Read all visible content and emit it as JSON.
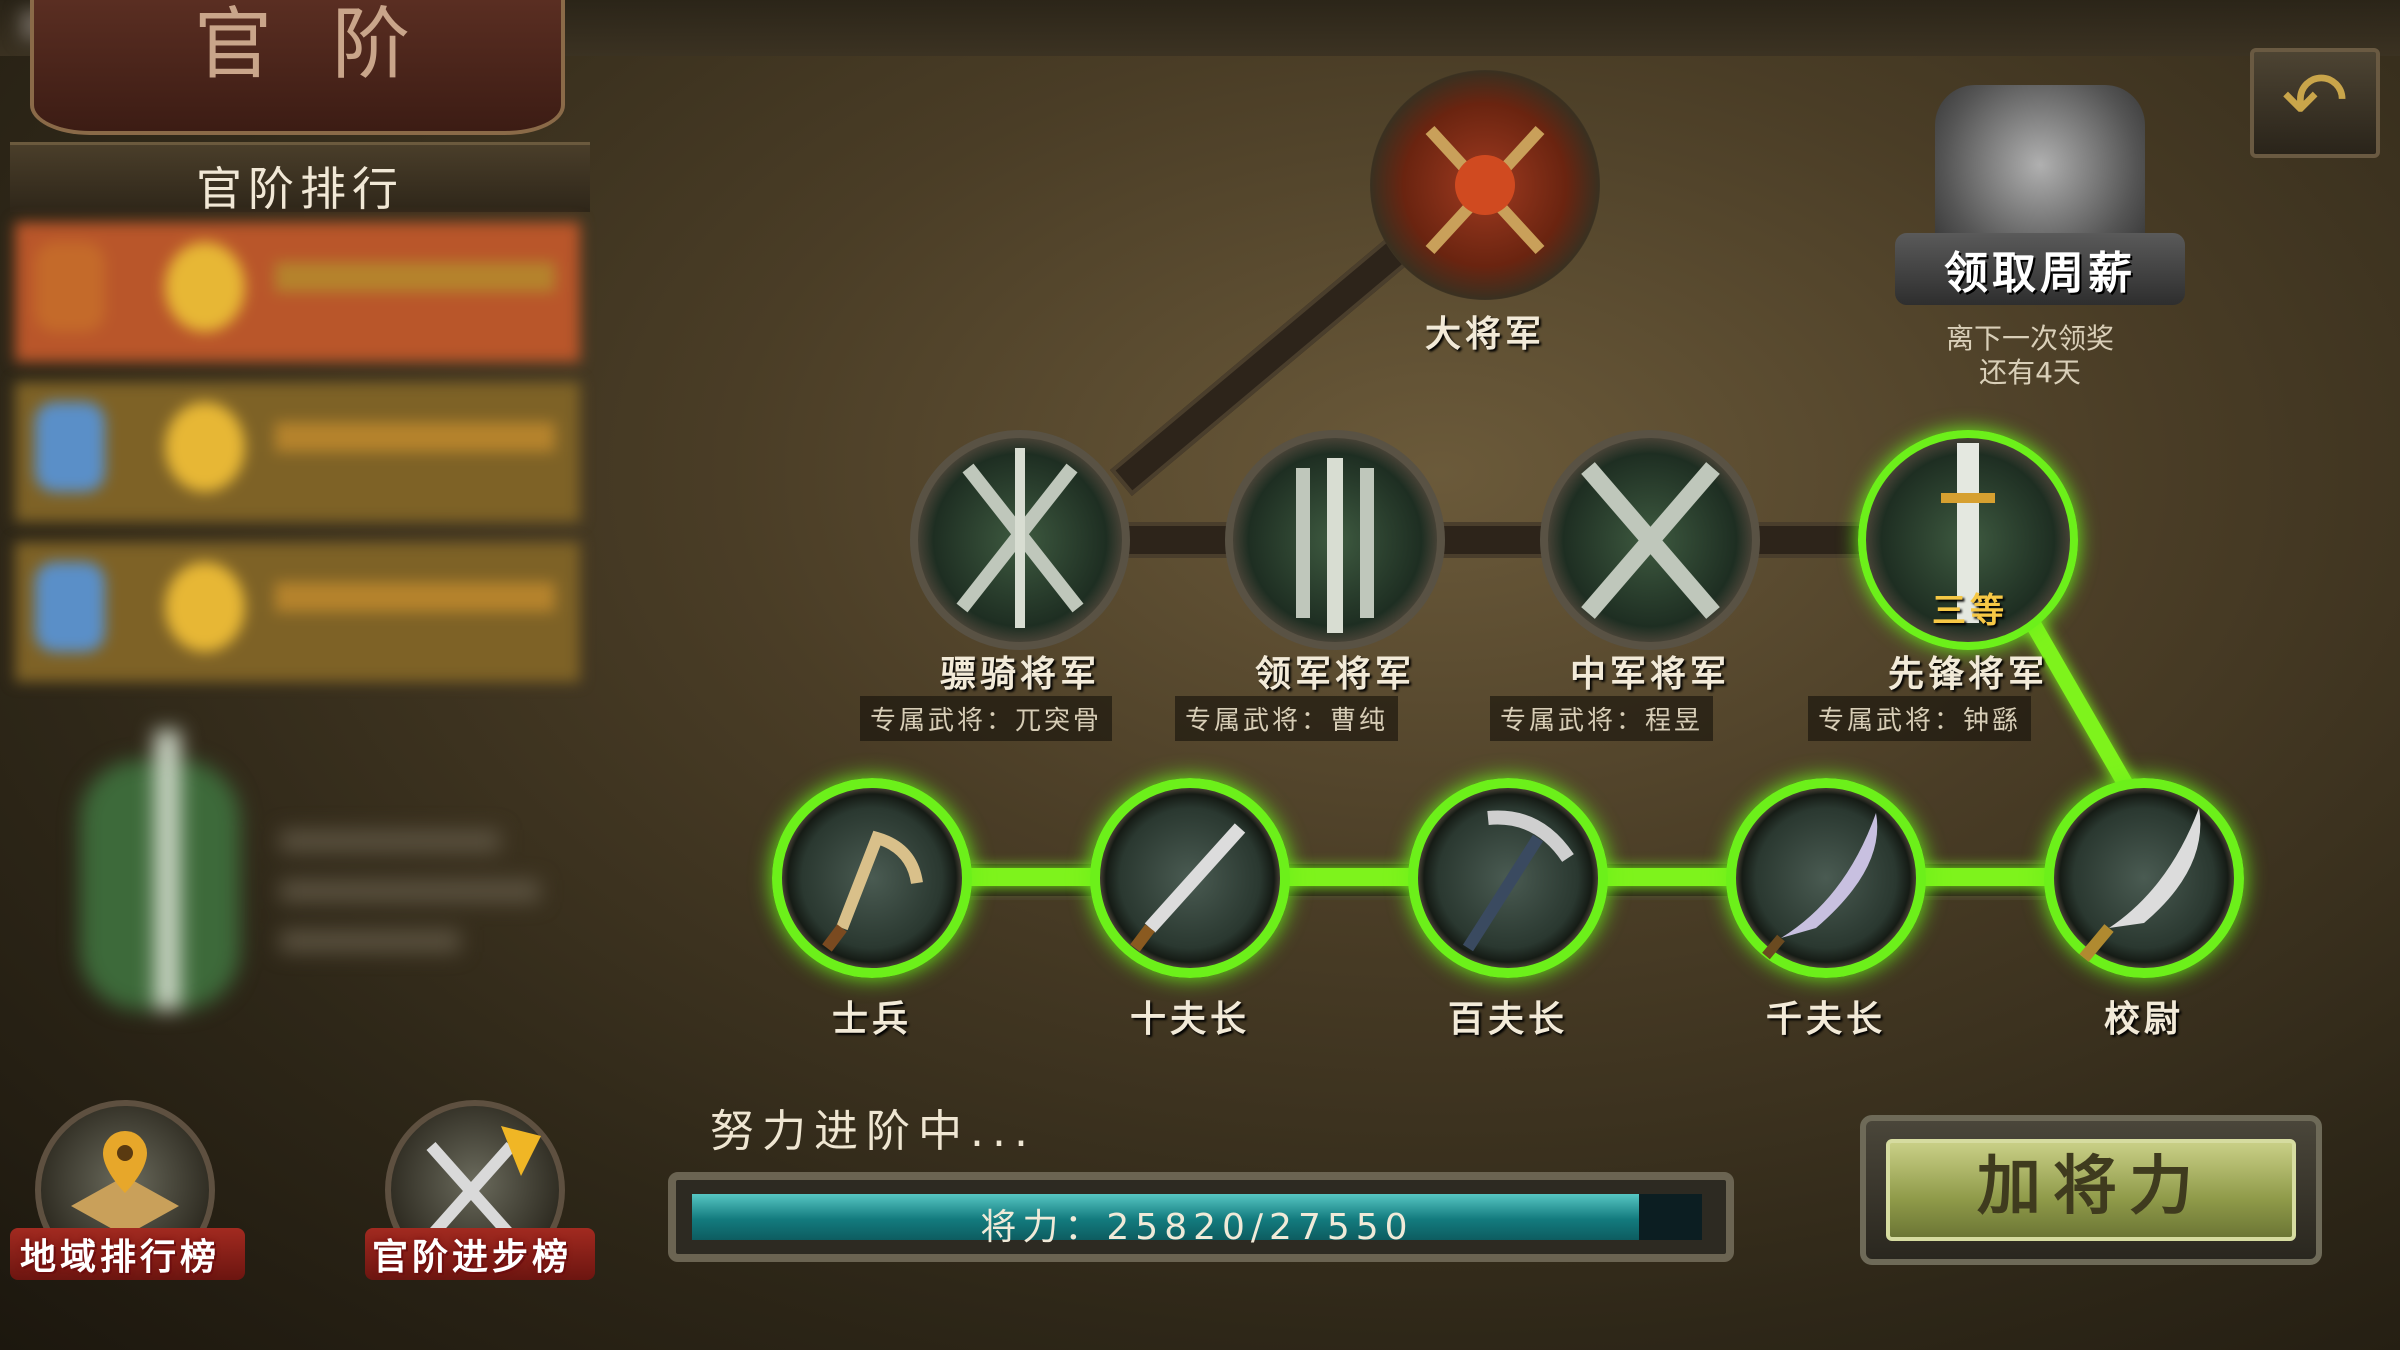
{
  "panel": {
    "title": "官阶",
    "ranking_title": "官阶排行"
  },
  "tiers_top": {
    "grand": {
      "name": "大将军"
    }
  },
  "tiers_mid": [
    {
      "name": "骠骑将军",
      "exclusive": "专属武将：兀突骨"
    },
    {
      "name": "领军将军",
      "exclusive": "专属武将：曹纯"
    },
    {
      "name": "中军将军",
      "exclusive": "专属武将：程昱"
    },
    {
      "name": "先锋将军",
      "exclusive": "专属武将：钟繇",
      "badge": "三等"
    }
  ],
  "tiers_low": [
    {
      "name": "士兵"
    },
    {
      "name": "十夫长"
    },
    {
      "name": "百夫长"
    },
    {
      "name": "千夫长"
    },
    {
      "name": "校尉"
    }
  ],
  "reward": {
    "label": "领取周薪",
    "note_line1": "离下一次领奖",
    "note_line2": "还有4天"
  },
  "bottom_buttons": {
    "regional": "地域排行榜",
    "progress": "官阶进步榜"
  },
  "progress": {
    "status": "努力进阶中...",
    "text": "将力：25820/27550",
    "current": 25820,
    "max": 27550
  },
  "add_button": "加将力",
  "back_icon": "↶",
  "colors": {
    "active_green": "#6cf01a",
    "bar_teal": "#137b7e"
  }
}
